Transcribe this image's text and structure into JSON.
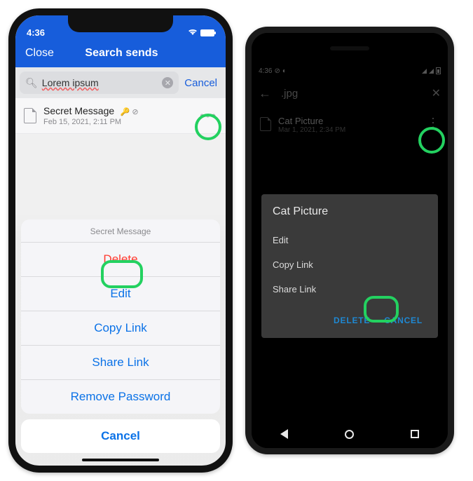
{
  "ios": {
    "status_time": "4:36",
    "nav": {
      "close": "Close",
      "title": "Search sends"
    },
    "search": {
      "value": "Lorem ipsum",
      "cancel": "Cancel"
    },
    "item": {
      "name": "Secret Message",
      "badges": "🔑 ⊘",
      "subtitle": "Feb 15, 2021, 2:11 PM"
    },
    "sheet": {
      "title": "Secret Message",
      "delete": "Delete",
      "edit": "Edit",
      "copy": "Copy Link",
      "share": "Share Link",
      "remove_pw": "Remove Password",
      "cancel": "Cancel"
    }
  },
  "android": {
    "status_time": "4:36",
    "appbar": {
      "query": ".jpg"
    },
    "item": {
      "name": "Cat Picture",
      "subtitle": "Mar 1, 2021, 2:34 PM"
    },
    "dialog": {
      "title": "Cat Picture",
      "edit": "Edit",
      "copy": "Copy Link",
      "share": "Share Link",
      "delete": "DELETE",
      "cancel": "CANCEL"
    }
  }
}
